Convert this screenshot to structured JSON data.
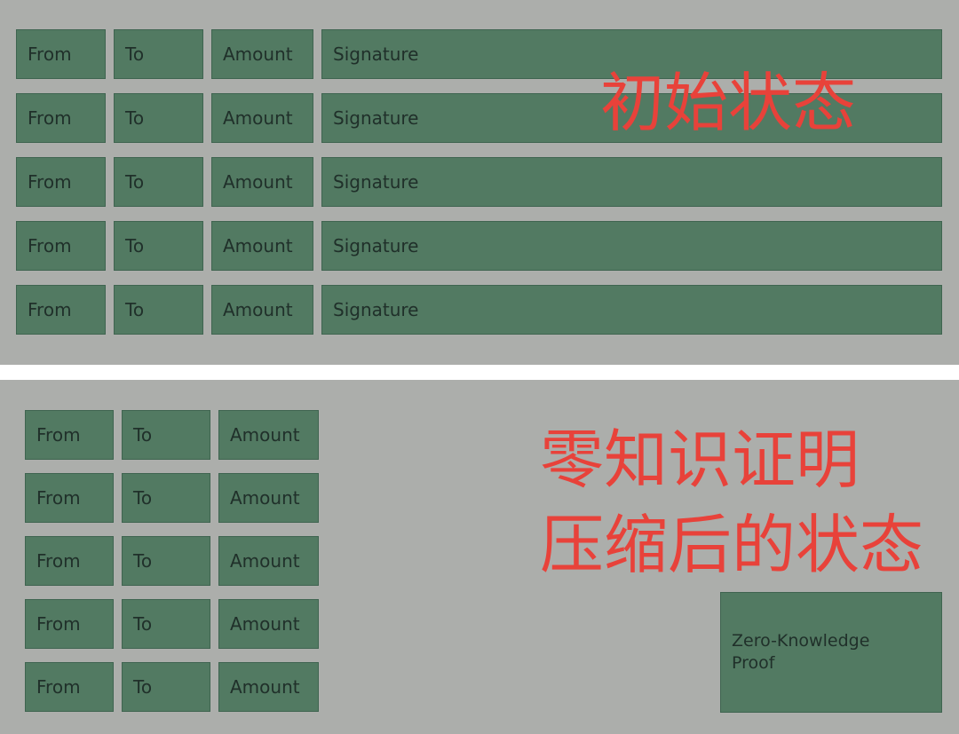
{
  "initial_state": {
    "caption": "初始状态",
    "rows": [
      {
        "from": "From",
        "to": "To",
        "amount": "Amount",
        "signature": "Signature"
      },
      {
        "from": "From",
        "to": "To",
        "amount": "Amount",
        "signature": "Signature"
      },
      {
        "from": "From",
        "to": "To",
        "amount": "Amount",
        "signature": "Signature"
      },
      {
        "from": "From",
        "to": "To",
        "amount": "Amount",
        "signature": "Signature"
      },
      {
        "from": "From",
        "to": "To",
        "amount": "Amount",
        "signature": "Signature"
      }
    ]
  },
  "compressed_state": {
    "caption_line1": "零知识证明",
    "caption_line2": "压缩后的状态",
    "rows": [
      {
        "from": "From",
        "to": "To",
        "amount": "Amount"
      },
      {
        "from": "From",
        "to": "To",
        "amount": "Amount"
      },
      {
        "from": "From",
        "to": "To",
        "amount": "Amount"
      },
      {
        "from": "From",
        "to": "To",
        "amount": "Amount"
      },
      {
        "from": "From",
        "to": "To",
        "amount": "Amount"
      }
    ],
    "proof_label_line1": "Zero-Knowledge",
    "proof_label_line2": "Proof"
  },
  "colors": {
    "panel_background": "#acaeab",
    "box_fill": "#527a62",
    "caption_text": "#e8423a",
    "divider": "#ffffff"
  }
}
